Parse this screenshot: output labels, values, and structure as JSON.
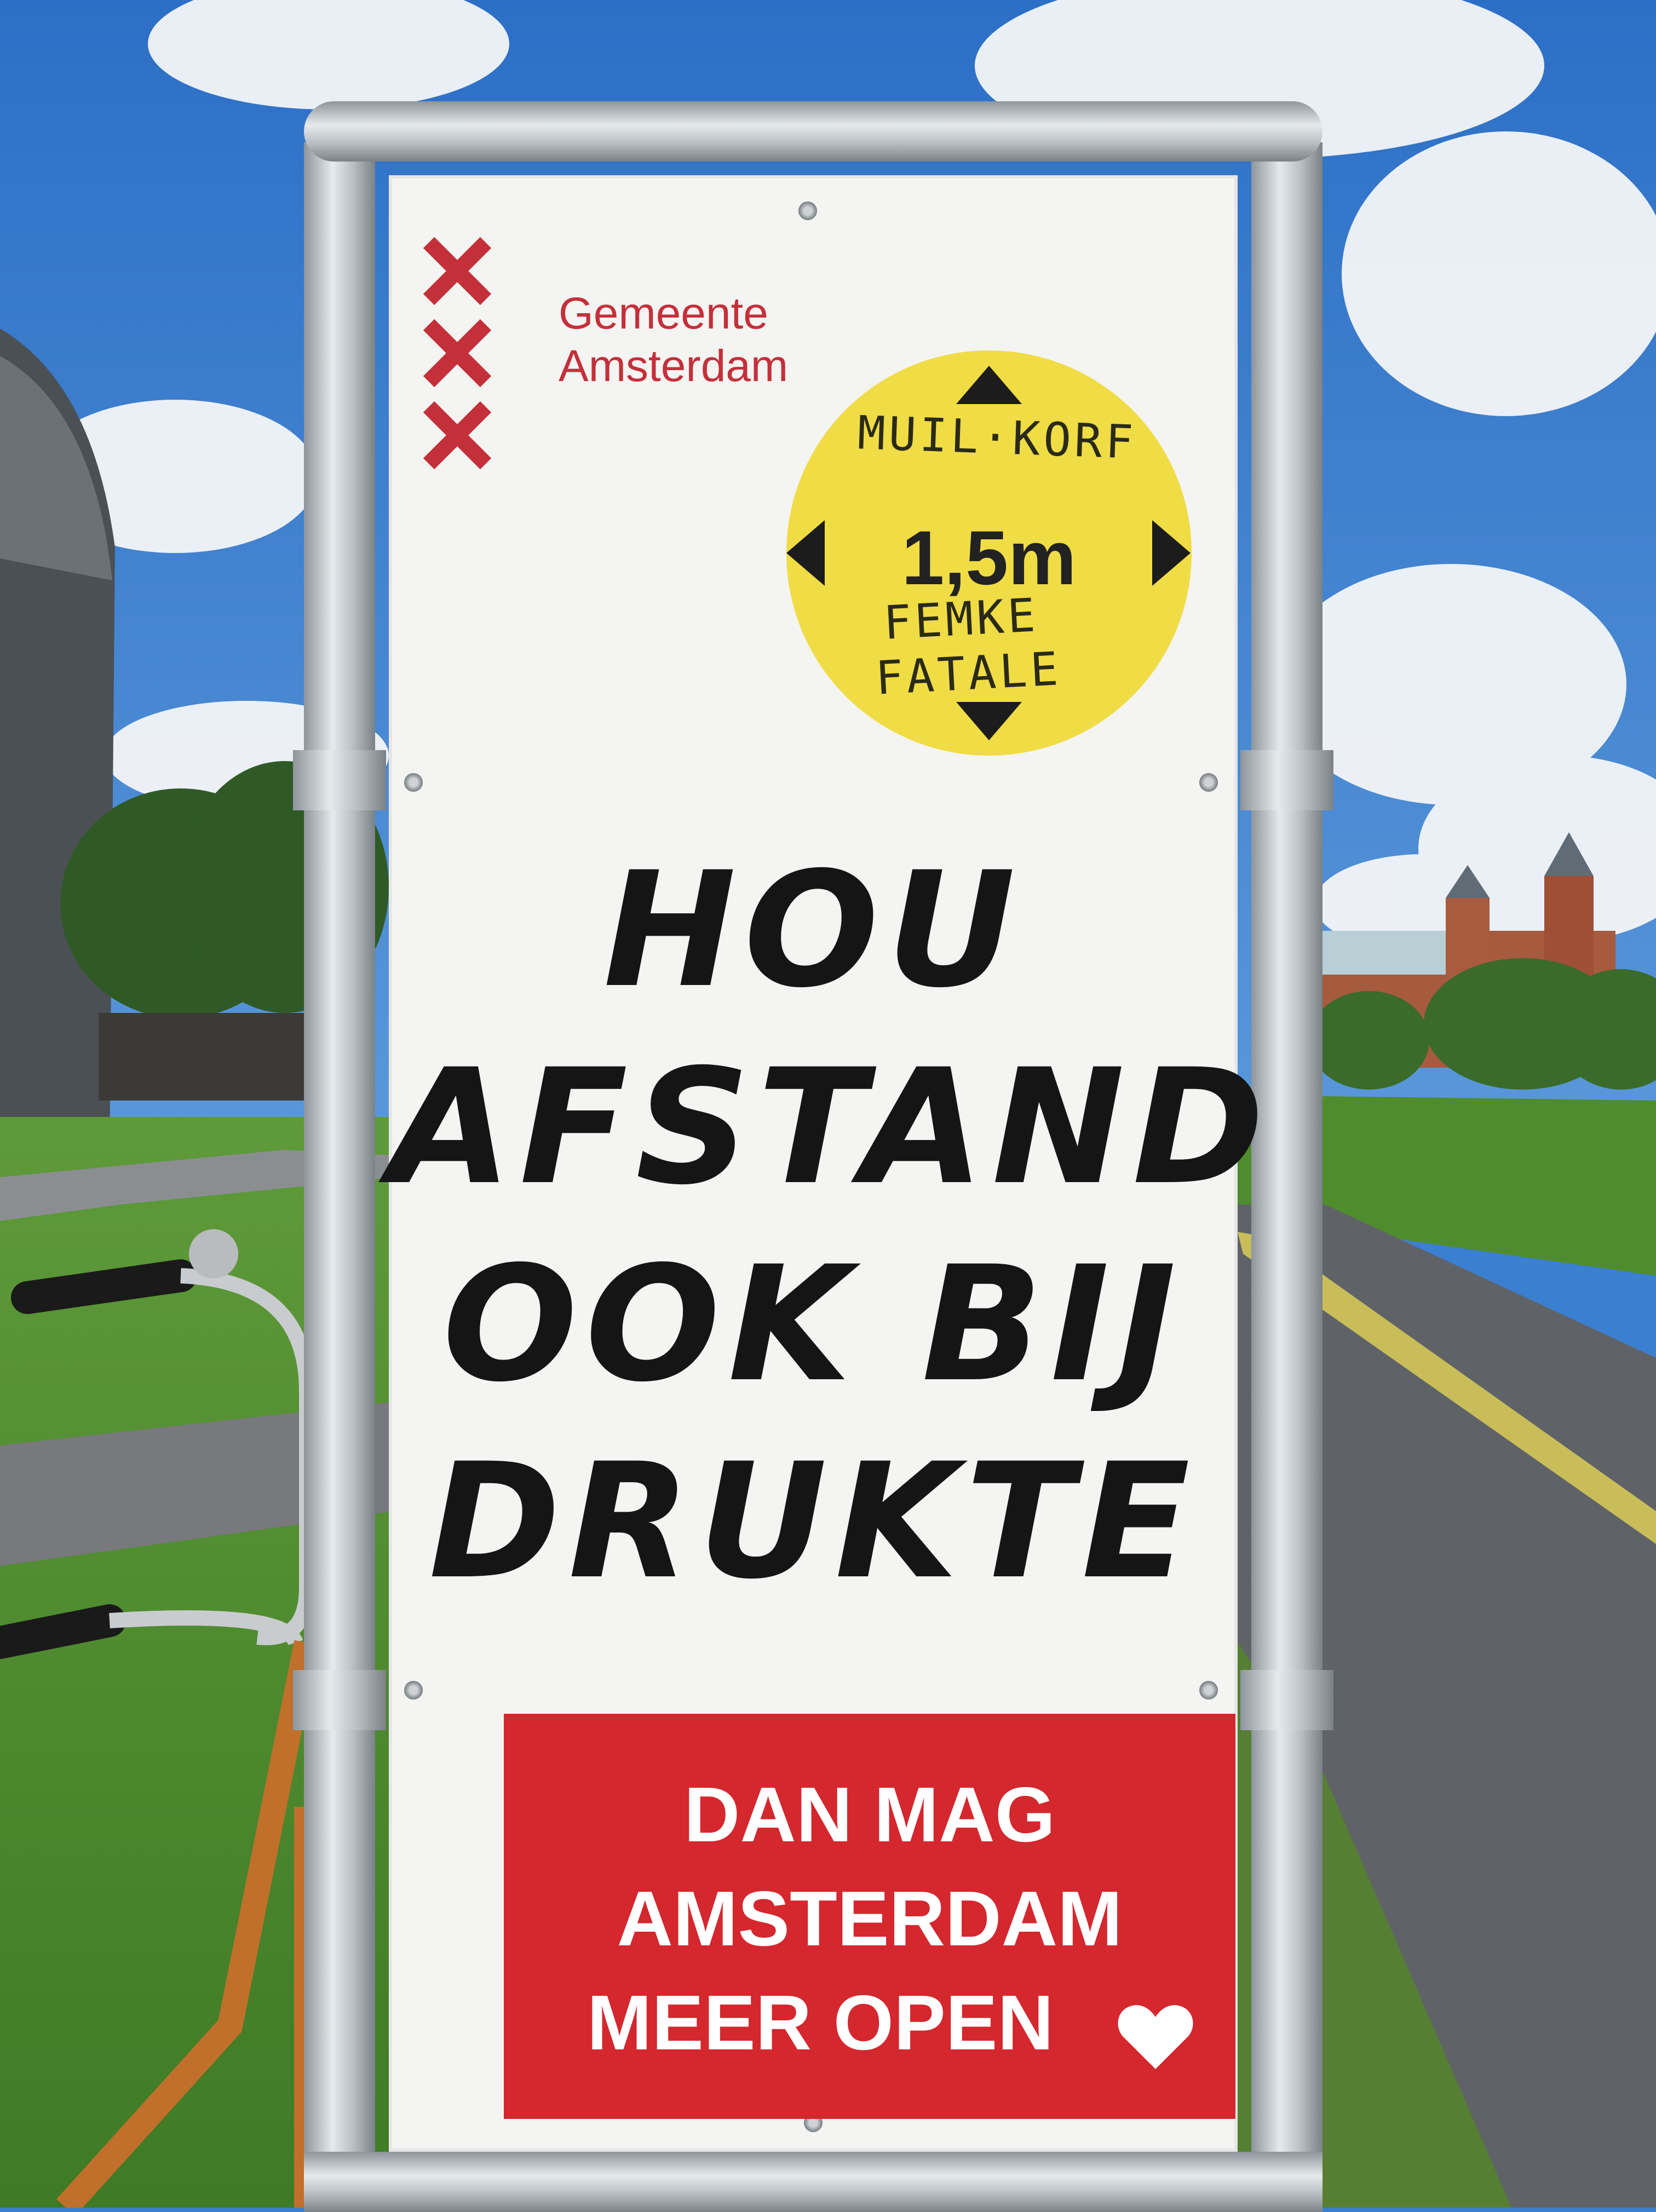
{
  "sign": {
    "org_line1": "Gemeente",
    "org_line2": "Amsterdam",
    "distance_label": "1,5m",
    "graffiti_top": "MUIL·KORF",
    "graffiti_bottom_line1": "FEMKE",
    "graffiti_bottom_line2": "FATALE",
    "headline": [
      "HOU",
      "AFSTAND",
      "OOK BIJ",
      "DRUKTE"
    ],
    "banner": [
      "DAN MAG",
      "AMSTERDAM",
      "MEER OPEN"
    ]
  },
  "colors": {
    "sky": "#3a7fd0",
    "grass": "#4e8c2e",
    "amsterdam_red": "#d4272e",
    "distance_yellow": "#f0dc45",
    "sign_white": "#f4f4f2"
  },
  "icons": [
    "amsterdam-x-icon",
    "arrow-up-icon",
    "arrow-down-icon",
    "arrow-left-icon",
    "arrow-right-icon",
    "heart-icon"
  ]
}
